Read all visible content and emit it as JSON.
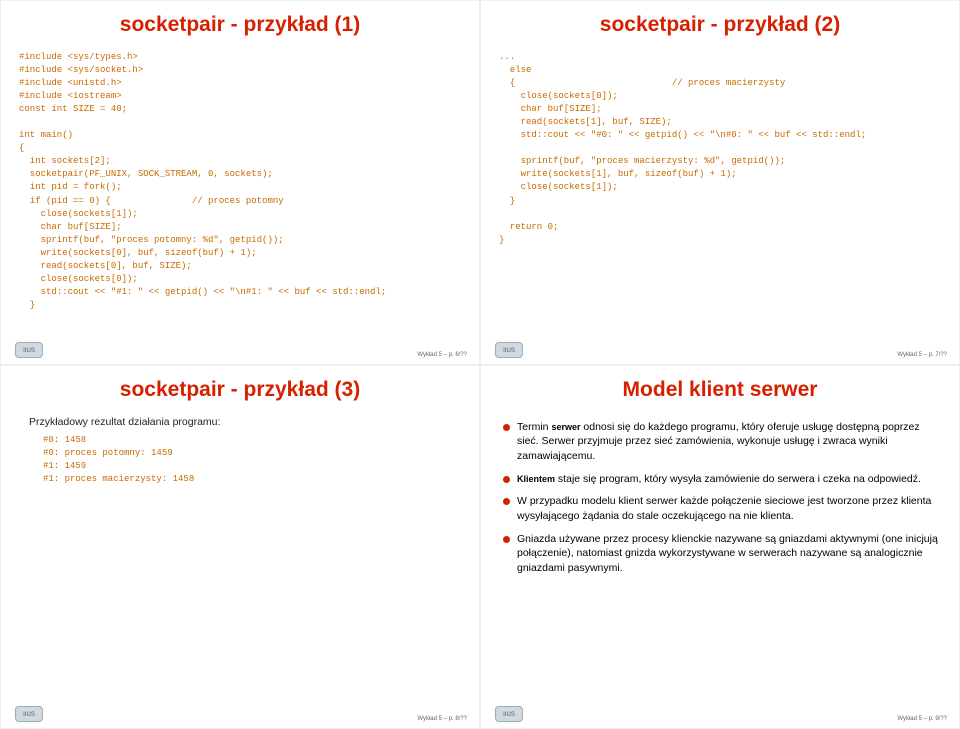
{
  "slides": {
    "tl": {
      "title": "socketpair - przykład (1)",
      "code": "#include <sys/types.h>\n#include <sys/socket.h>\n#include <unistd.h>\n#include <iostream>\nconst int SIZE = 40;\n\nint main()\n{\n  int sockets[2];\n  socketpair(PF_UNIX, SOCK_STREAM, 0, sockets);\n  int pid = fork();\n  if (pid == 0) {               // proces potomny\n    close(sockets[1]);\n    char buf[SIZE];\n    sprintf(buf, \"proces potomny: %d\", getpid());\n    write(sockets[0], buf, sizeof(buf) + 1);\n    read(sockets[0], buf, SIZE);\n    close(sockets[0]);\n    std::cout << \"#1: \" << getpid() << \"\\n#1: \" << buf << std::endl;\n  }",
      "page": "Wykład 5 – p. 6/??"
    },
    "tr": {
      "title": "socketpair - przykład (2)",
      "code": "...\n  else\n  {                             // proces macierzysty\n    close(sockets[0]);\n    char buf[SIZE];\n    read(sockets[1], buf, SIZE);\n    std::cout << \"#0: \" << getpid() << \"\\n#0: \" << buf << std::endl;\n\n    sprintf(buf, \"proces macierzysty: %d\", getpid());\n    write(sockets[1], buf, sizeof(buf) + 1);\n    close(sockets[1]);\n  }\n\n  return 0;\n}",
      "page": "Wykład 5 – p. 7/??"
    },
    "bl": {
      "title": "socketpair - przykład (3)",
      "intro": "Przykładowy rezultat działania programu:",
      "code": "#0: 1458\n#0: proces potomny: 1459\n#1: 1459\n#1: proces macierzysty: 1458",
      "page": "Wykład 5 – p. 8/??"
    },
    "br": {
      "title": "Model klient serwer",
      "bullets": [
        {
          "prefix": "Termin ",
          "strong": "serwer",
          "rest": " odnosi się do każdego programu, który oferuje usługę dostępną poprzez sieć. Serwer przyjmuje przez sieć zamówienia, wykonuje usługę i zwraca wyniki zamawiającemu."
        },
        {
          "prefix": "",
          "strong": "Klientem",
          "rest": " staje się program, który wysyła zamówienie do serwera i czeka na odpowiedź."
        },
        {
          "prefix": "",
          "strong": "",
          "rest": "W przypadku modelu klient serwer każde połączenie sieciowe jest tworzone przez klienta wysyłającego żądania do stale oczekującego na nie klienta."
        },
        {
          "prefix": "",
          "strong": "",
          "rest": "Gniazda używane przez procesy klienckie nazywane są gniazdami aktywnymi (one inicjują połączenie), natomiast gnizda wykorzystywane w serwerach nazywane są analogicznie gniazdami pasywnymi."
        }
      ],
      "page": "Wykład 5 – p. 9/??"
    }
  },
  "logoText": "IIUS"
}
